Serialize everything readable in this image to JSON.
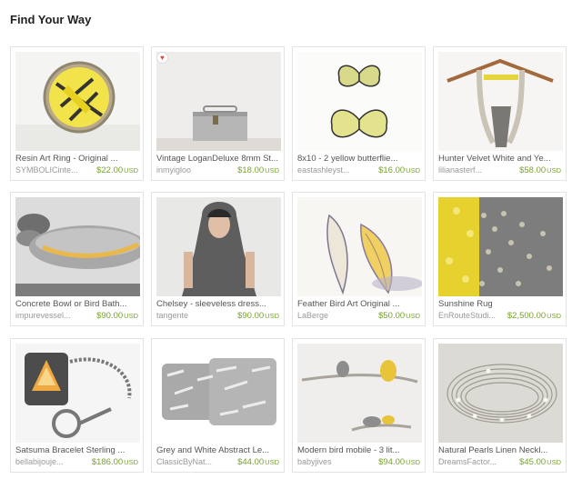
{
  "page": {
    "title": "Find Your Way"
  },
  "items": [
    {
      "title": "Resin Art Ring - Original ...",
      "shop": "SYMBOLICinte...",
      "price": "$22.00",
      "currency": "USD",
      "image_icon": "resin-ring"
    },
    {
      "title": "Vintage LoganDeluxe 8mm St...",
      "shop": "inmyigloo",
      "price": "$18.00",
      "currency": "USD",
      "image_icon": "vintage-case",
      "favorite": "♥"
    },
    {
      "title": "8x10 - 2 yellow butterflie...",
      "shop": "eastashleyst...",
      "price": "$16.00",
      "currency": "USD",
      "image_icon": "butterflies"
    },
    {
      "title": "Hunter Velvet White and Ye...",
      "shop": "lilianasterf...",
      "price": "$58.00",
      "currency": "USD",
      "image_icon": "necklace-hanger"
    },
    {
      "title": "Concrete Bowl or Bird Bath...",
      "shop": "impurevessel...",
      "price": "$90.00",
      "currency": "USD",
      "image_icon": "concrete-bowl"
    },
    {
      "title": "Chelsey - sleeveless dress...",
      "shop": "tangente",
      "price": "$90.00",
      "currency": "USD",
      "image_icon": "hooded-dress"
    },
    {
      "title": "Feather Bird Art Original ...",
      "shop": "LaBerge",
      "price": "$50.00",
      "currency": "USD",
      "image_icon": "feathers"
    },
    {
      "title": "Sunshine Rug",
      "shop": "EnRouteStudi...",
      "price": "$2,500.00",
      "currency": "USD",
      "image_icon": "rug"
    },
    {
      "title": "Satsuma Bracelet Sterling ...",
      "shop": "bellabijouje...",
      "price": "$186.00",
      "currency": "USD",
      "image_icon": "bracelet"
    },
    {
      "title": "Grey and White Abstract Le...",
      "shop": "ClassicByNat...",
      "price": "$44.00",
      "currency": "USD",
      "image_icon": "pillows"
    },
    {
      "title": "Modern bird mobile - 3 lit...",
      "shop": "babyjives",
      "price": "$94.00",
      "currency": "USD",
      "image_icon": "bird-mobile"
    },
    {
      "title": "Natural Pearls Linen Neckl...",
      "shop": "DreamsFactor...",
      "price": "$45.00",
      "currency": "USD",
      "image_icon": "pearl-linen"
    }
  ],
  "colors": {
    "price": "#78a22f",
    "title": "#555555",
    "shop": "#999999",
    "border": "#e3e3e3"
  }
}
